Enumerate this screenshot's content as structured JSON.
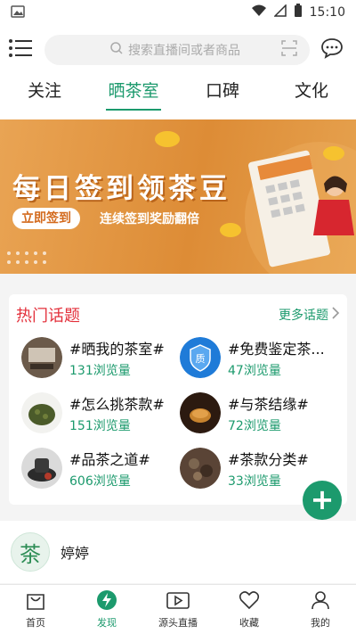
{
  "status": {
    "time": "15:10"
  },
  "search": {
    "placeholder": "搜索直播间或者商品"
  },
  "tabs": [
    {
      "label": "关注"
    },
    {
      "label": "晒茶室"
    },
    {
      "label": "口碑"
    },
    {
      "label": "文化"
    }
  ],
  "banner": {
    "title": "每日签到领茶豆",
    "cta": "立即签到",
    "subline": "连续签到奖励翻倍"
  },
  "hot": {
    "title": "热门话题",
    "more": "更多话题",
    "topics": [
      {
        "name": "#晒我的茶室#",
        "views": "131浏览量"
      },
      {
        "name": "#免费鉴定茶...",
        "views": "47浏览量"
      },
      {
        "name": "#怎么挑茶款#",
        "views": "151浏览量"
      },
      {
        "name": "#与茶结缘#",
        "views": "72浏览量"
      },
      {
        "name": "#品茶之道#",
        "views": "606浏览量"
      },
      {
        "name": "#茶款分类#",
        "views": "33浏览量"
      }
    ]
  },
  "user": {
    "name": "婷婷"
  },
  "nav": [
    {
      "label": "首页"
    },
    {
      "label": "发现"
    },
    {
      "label": "源头直播"
    },
    {
      "label": "收藏"
    },
    {
      "label": "我的"
    }
  ],
  "colors": {
    "accent": "#1c9a6d",
    "hot": "#e3303b"
  }
}
